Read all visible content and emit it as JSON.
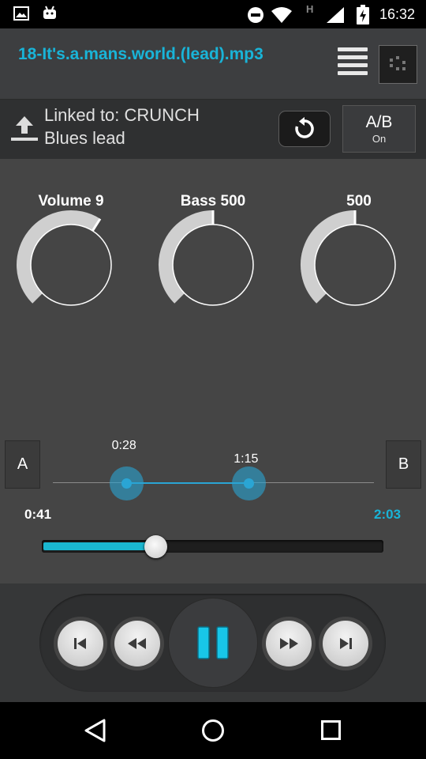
{
  "status_bar": {
    "time": "16:32",
    "icons": [
      "image-notification-icon",
      "android-debug-icon",
      "do-not-disturb-icon",
      "wifi-icon",
      "hspa-icon",
      "cell-signal-icon",
      "battery-charging-icon"
    ],
    "network_letter": "H"
  },
  "header": {
    "title": "18-It's.a.mans.world.(lead).mp3",
    "icons": [
      "menu-icon",
      "visualizer-icon"
    ]
  },
  "link_bar": {
    "linked_line": "Linked to: CRUNCH",
    "preset_line": "Blues lead",
    "ab_label": "A/B",
    "ab_state": "On",
    "icons": [
      "upload-icon",
      "reset-icon"
    ]
  },
  "knobs": [
    {
      "label": "Volume 9",
      "level": 0.62
    },
    {
      "label": "Bass 500",
      "level": 0.5
    },
    {
      "label": "500",
      "level": 0.5
    }
  ],
  "ab_loop": {
    "a_label": "A",
    "b_label": "B",
    "start_time": "0:28",
    "end_time": "1:15",
    "start_fraction": 0.23,
    "end_fraction": 0.61
  },
  "playback": {
    "position": "0:41",
    "duration": "2:03",
    "progress": 0.33
  },
  "transport": {
    "buttons": [
      "previous-track",
      "rewind",
      "pause",
      "fast-forward",
      "next-track"
    ],
    "state": "playing"
  },
  "nav_bar": {
    "buttons": [
      "back",
      "home",
      "recents"
    ]
  },
  "colors": {
    "accent": "#19b4d8",
    "loop_accent": "#2aa5d4",
    "progress_fill": "#1ab6cf",
    "pause_icon": "#18c6e8",
    "background": "#454545"
  }
}
